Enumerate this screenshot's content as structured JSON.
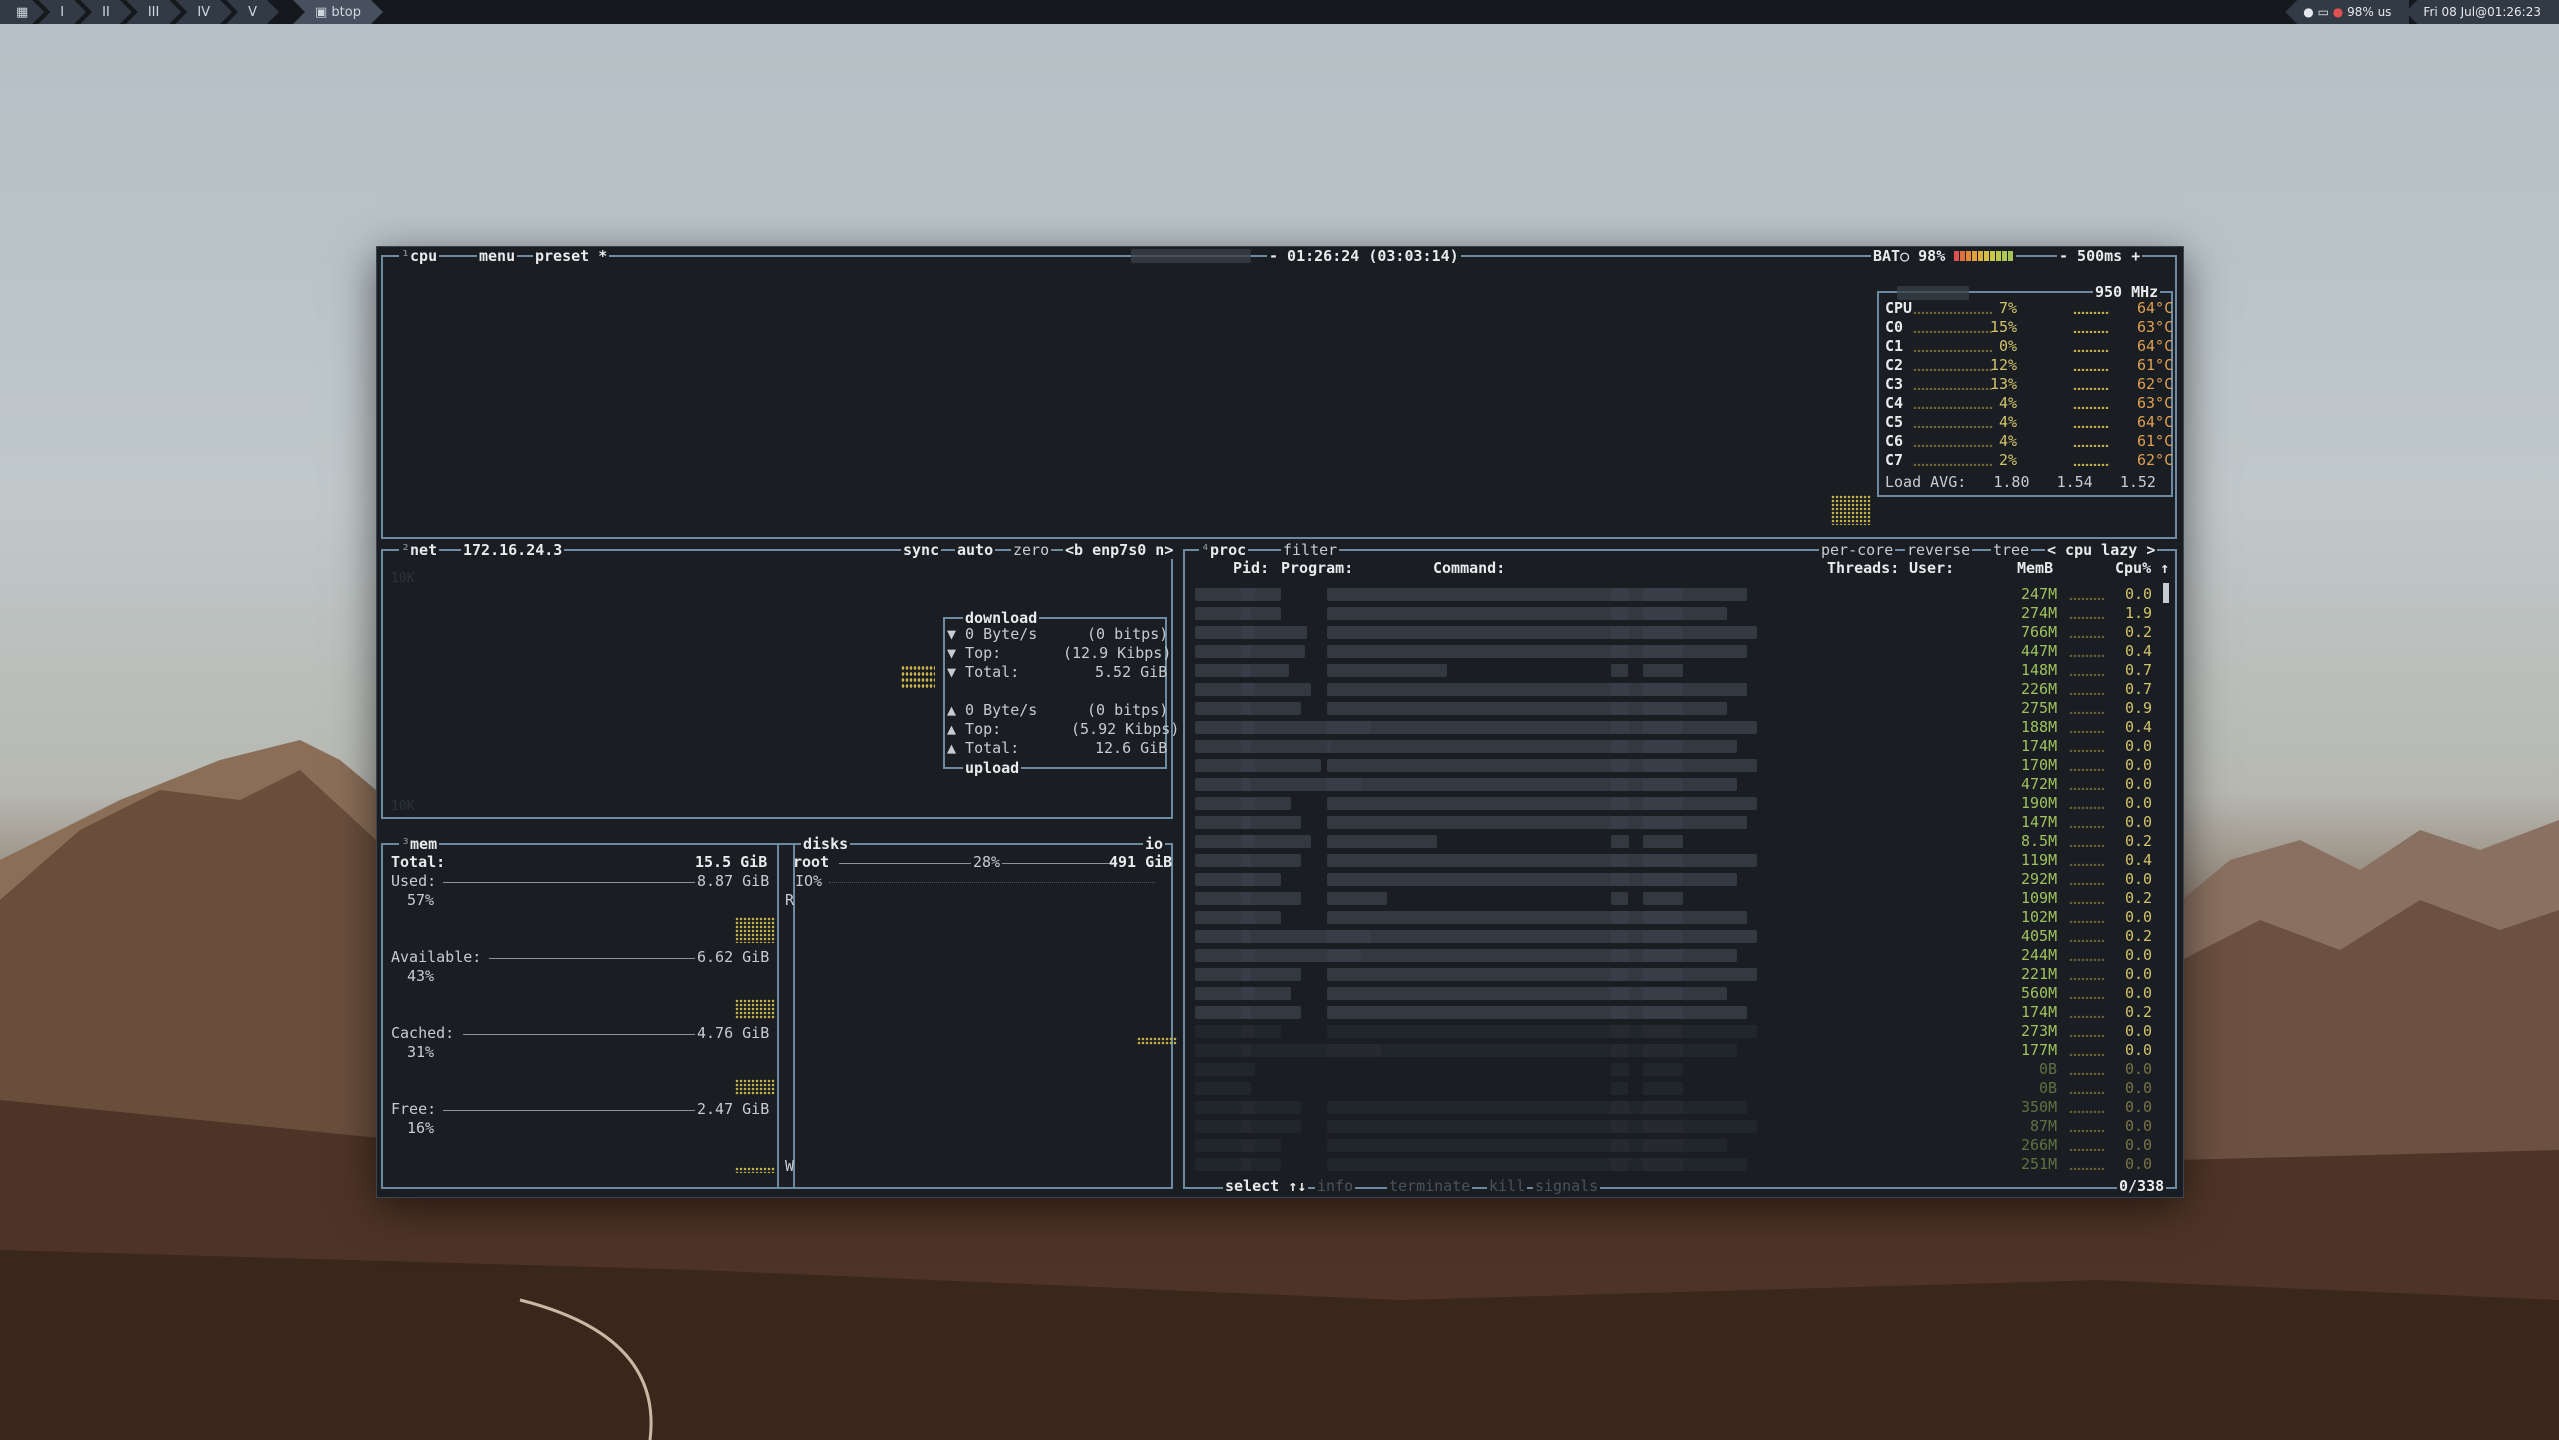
{
  "topbar": {
    "workspaces": [
      "I",
      "II",
      "III",
      "IV",
      "V"
    ],
    "active_app": "btop",
    "battery": "98% us",
    "datetime": "Fri 08 Jul@01:26:23"
  },
  "cpu_box": {
    "title": "cpu",
    "menu": "menu",
    "preset": "preset *",
    "clock": "- 01:26:24 (03:03:14)",
    "battery": "BAT○ 98%",
    "interval": "- 500ms +",
    "freq": "950 MHz",
    "cores": [
      {
        "name": "CPU",
        "pct": "7%",
        "temp": "64°C"
      },
      {
        "name": "C0",
        "pct": "15%",
        "temp": "63°C"
      },
      {
        "name": "C1",
        "pct": "0%",
        "temp": "64°C"
      },
      {
        "name": "C2",
        "pct": "12%",
        "temp": "61°C"
      },
      {
        "name": "C3",
        "pct": "13%",
        "temp": "62°C"
      },
      {
        "name": "C4",
        "pct": "4%",
        "temp": "63°C"
      },
      {
        "name": "C5",
        "pct": "4%",
        "temp": "64°C"
      },
      {
        "name": "C6",
        "pct": "4%",
        "temp": "61°C"
      },
      {
        "name": "C7",
        "pct": "2%",
        "temp": "62°C"
      }
    ],
    "load_avg_label": "Load AVG:",
    "load_avg": [
      "1.80",
      "1.54",
      "1.52"
    ]
  },
  "net_box": {
    "title": "net",
    "ip": "172.16.24.3",
    "sync": "sync",
    "auto": "auto",
    "zero": "zero",
    "iface": "<b enp7s0 n>",
    "scale_top": "10K",
    "scale_bottom": "10K",
    "download_label": "download",
    "upload_label": "upload",
    "download": {
      "rate": "▼ 0 Byte/s",
      "rate_bits": "(0 bitps)",
      "top": "▼ Top:",
      "top_val": "(12.9 Kibps)",
      "total": "▼ Total:",
      "total_val": "5.52 GiB"
    },
    "upload": {
      "rate": "▲ 0 Byte/s",
      "rate_bits": "(0 bitps)",
      "top": "▲ Top:",
      "top_val": "(5.92 Kibps)",
      "total": "▲ Total:",
      "total_val": "12.6 GiB"
    }
  },
  "mem_box": {
    "title": "mem",
    "total_label": "Total:",
    "total": "15.5 GiB",
    "used_label": "Used:",
    "used": "8.87 GiB",
    "used_pct": "57%",
    "available_label": "Available:",
    "available": "6.62 GiB",
    "available_pct": "43%",
    "cached_label": "Cached:",
    "cached": "4.76 GiB",
    "cached_pct": "31%",
    "free_label": "Free:",
    "free": "2.47 GiB",
    "free_pct": "16%"
  },
  "disks_box": {
    "title": "disks",
    "io": "io",
    "root": "root",
    "root_pct": "28%",
    "root_size": "491 GiB",
    "io_pct": "IO%",
    "r": "R",
    "w": "W"
  },
  "proc_box": {
    "title": "proc",
    "filter": "filter",
    "per_core": "per-core",
    "reverse": "reverse",
    "tree": "tree",
    "sort": "< cpu lazy >",
    "headers": {
      "pid": "Pid:",
      "program": "Program:",
      "command": "Command:",
      "threads": "Threads:",
      "user": "User:",
      "mem": "MemB",
      "cpu": "Cpu%"
    },
    "mem_values": [
      "247M",
      "274M",
      "766M",
      "447M",
      "148M",
      "226M",
      "275M",
      "188M",
      "174M",
      "170M",
      "472M",
      "190M",
      "147M",
      "8.5M",
      "119M",
      "292M",
      "109M",
      "102M",
      "405M",
      "244M",
      "221M",
      "560M",
      "174M",
      "273M",
      "177M",
      "0B",
      "0B",
      "350M",
      "87M",
      "266M",
      "251M"
    ],
    "cpu_values": [
      "0.0",
      "1.9",
      "0.2",
      "0.4",
      "0.7",
      "0.7",
      "0.9",
      "0.4",
      "0.0",
      "0.0",
      "0.0",
      "0.0",
      "0.0",
      "0.2",
      "0.4",
      "0.0",
      "0.2",
      "0.0",
      "0.2",
      "0.0",
      "0.0",
      "0.0",
      "0.2",
      "0.0",
      "0.0",
      "0.0",
      "0.0",
      "0.0",
      "0.0",
      "0.0",
      "0.0"
    ],
    "select": "select ↑↓",
    "info": "info",
    "terminate": "terminate",
    "kill": "kill",
    "signals": "signals",
    "count": "0/338"
  }
}
